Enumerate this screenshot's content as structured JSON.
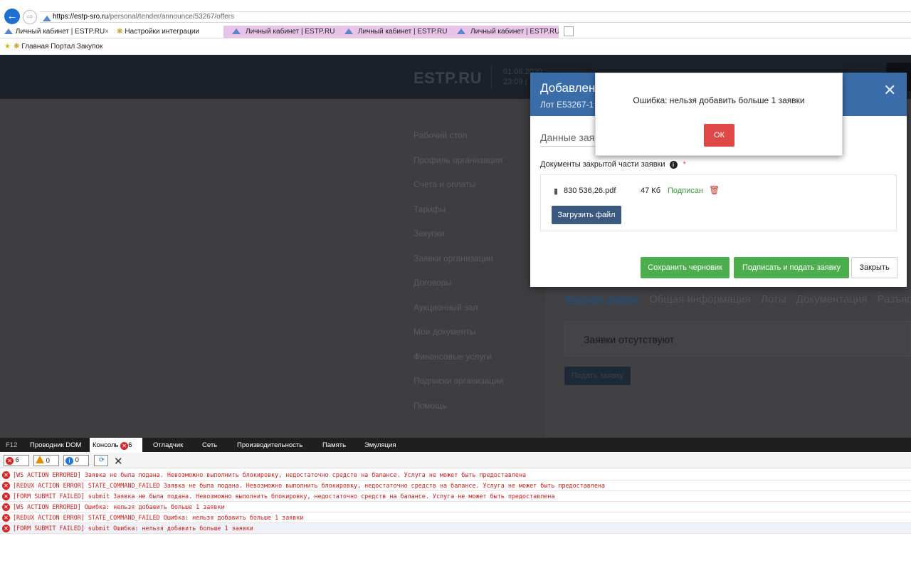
{
  "browser": {
    "url_host": "https://estp-sro.ru",
    "url_path": "/personal/tender/announce/53267/offers",
    "tabs": [
      {
        "label": "Личный кабинет | ESTP.RU"
      },
      {
        "label": "Настройки интеграции"
      },
      {
        "label": "Личный кабинет | ESTP.RU"
      },
      {
        "label": "Личный кабинет | ESTP.RU"
      },
      {
        "label": "Личный кабинет | ESTP.RU"
      }
    ],
    "favorites": {
      "label": "Главная Портал Закупок"
    }
  },
  "header": {
    "brand": "ESTP.RU",
    "date": "01.06.2020",
    "time": "23:09 ("
  },
  "sidebar": {
    "items": [
      "Рабочий стол",
      "Профиль организации",
      "Счета и оплаты",
      "Тарифы",
      "Закупки",
      "Заявки организации",
      "Договоры",
      "Аукционный зал",
      "Мои документы",
      "Финансовые услуги",
      "Подписки организации",
      "Помощь"
    ]
  },
  "content": {
    "tabs": [
      "Журнал заявок",
      "Общая информация",
      "Лоты",
      "Документация",
      "Разъяснения"
    ],
    "empty_text": "Заявки отсутствуют",
    "apply_button": "Подать заявку"
  },
  "modal": {
    "title": "Добавлен",
    "subtitle": "Лот E53267-1",
    "section": "Данные заяв",
    "docs_label": "Документы закрытой части заявки",
    "file": {
      "name": "830 536,26.pdf",
      "size": "47 Кб",
      "status": "Подписан"
    },
    "upload_button": "Загрузить файл",
    "save_draft": "Сохранить черновик",
    "sign_submit": "Подписать и подать заявку",
    "close": "Закрыть"
  },
  "alert": {
    "message": "Ошибка: нельзя добавить больше 1 заявки",
    "ok": "ОК"
  },
  "devtools": {
    "tabs": {
      "f12": "F12",
      "dom": "Проводник DOM",
      "console": "Консоль",
      "console_count": "6",
      "debugger": "Отладчик",
      "network": "Сеть",
      "performance": "Производительность",
      "memory": "Память",
      "emulation": "Эмуляция"
    },
    "filters": {
      "errors": "6",
      "warnings": "0",
      "info": "0"
    },
    "logs": [
      "[WS ACTION ERRORED] Заявка не была подана. Невозможно выполнить блокировку, недостаточно средств на балансе. Услуга не может быть предоставлена",
      "[REDUX ACTION ERROR] STATE_COMMAND_FAILED Заявка не была подана. Невозможно выполнить блокировку, недостаточно средств на балансе. Услуга не может быть предоставлена",
      "[FORM SUBMIT FAILED] submit Заявка не была подана. Невозможно выполнить блокировку, недостаточно средств на балансе. Услуга не может быть предоставлена",
      "[WS ACTION ERRORED] Ошибка: нельзя добавить больше 1 заявки",
      "[REDUX ACTION ERROR] STATE_COMMAND_FAILED Ошибка: нельзя добавить больше 1 заявки",
      "[FORM SUBMIT FAILED] submit Ошибка: нельзя добавить больше 1 заявки"
    ]
  },
  "colors": {
    "modal_header": "#3a6ca8",
    "success": "#4cae4c",
    "danger": "#e04848",
    "console_error": "#c8201e"
  }
}
